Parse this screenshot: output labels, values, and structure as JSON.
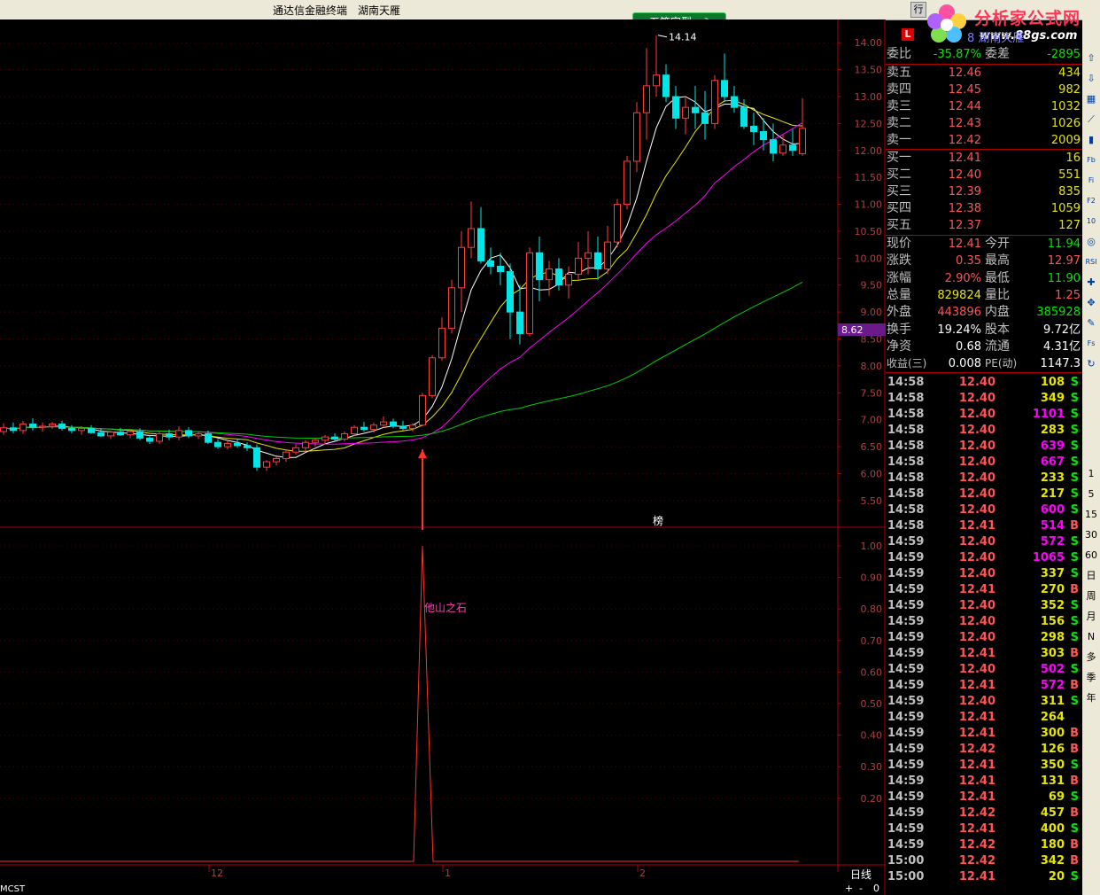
{
  "title_bar": {
    "app": "通达信金融终端",
    "user": "湖南天雁",
    "menu_btn": "行"
  },
  "logo": {
    "brand": "分析家公式网",
    "url": "www.88gs.com"
  },
  "ime": {
    "label": "五笔字型",
    "icon": "moon-icon"
  },
  "stock_header": {
    "code_text": "8 湖南天雁",
    "badge": "L"
  },
  "chart_data": [
    {
      "type": "candlestick",
      "title": "",
      "y_ticks": [
        "14.00",
        "13.50",
        "13.00",
        "12.50",
        "12.00",
        "11.50",
        "11.00",
        "10.50",
        "10.00",
        "9.50",
        "9.00",
        "8.50",
        "8.00",
        "7.50",
        "7.00",
        "6.50",
        "6.00",
        "5.50"
      ],
      "ylim": [
        5.3,
        14.3
      ],
      "high_label": "14.14",
      "current_price_tag": "8.62",
      "x_labels": [
        "12",
        "1",
        "2"
      ],
      "marker_text": "榜",
      "candles": [
        [
          6.78,
          6.93,
          6.72,
          6.85
        ],
        [
          6.85,
          6.95,
          6.75,
          6.8
        ],
        [
          6.8,
          6.98,
          6.74,
          6.92
        ],
        [
          6.92,
          7.03,
          6.8,
          6.86
        ],
        [
          6.86,
          6.95,
          6.78,
          6.88
        ],
        [
          6.88,
          6.96,
          6.83,
          6.92
        ],
        [
          6.92,
          6.98,
          6.8,
          6.84
        ],
        [
          6.84,
          6.9,
          6.75,
          6.8
        ],
        [
          6.8,
          6.88,
          6.72,
          6.84
        ],
        [
          6.84,
          6.9,
          6.74,
          6.76
        ],
        [
          6.76,
          6.84,
          6.68,
          6.7
        ],
        [
          6.7,
          6.8,
          6.64,
          6.77
        ],
        [
          6.77,
          6.85,
          6.7,
          6.72
        ],
        [
          6.72,
          6.82,
          6.66,
          6.78
        ],
        [
          6.78,
          6.84,
          6.62,
          6.66
        ],
        [
          6.66,
          6.72,
          6.55,
          6.6
        ],
        [
          6.6,
          6.78,
          6.55,
          6.74
        ],
        [
          6.74,
          6.82,
          6.62,
          6.68
        ],
        [
          6.68,
          6.88,
          6.62,
          6.8
        ],
        [
          6.8,
          6.86,
          6.66,
          6.7
        ],
        [
          6.7,
          6.78,
          6.64,
          6.74
        ],
        [
          6.74,
          6.8,
          6.55,
          6.58
        ],
        [
          6.58,
          6.64,
          6.46,
          6.5
        ],
        [
          6.5,
          6.62,
          6.45,
          6.56
        ],
        [
          6.56,
          6.64,
          6.48,
          6.52
        ],
        [
          6.52,
          6.58,
          6.42,
          6.48
        ],
        [
          6.48,
          6.54,
          6.05,
          6.12
        ],
        [
          6.12,
          6.25,
          6.05,
          6.22
        ],
        [
          6.22,
          6.32,
          6.15,
          6.28
        ],
        [
          6.28,
          6.45,
          6.22,
          6.4
        ],
        [
          6.4,
          6.55,
          6.35,
          6.48
        ],
        [
          6.48,
          6.62,
          6.4,
          6.58
        ],
        [
          6.58,
          6.66,
          6.5,
          6.62
        ],
        [
          6.62,
          6.72,
          6.55,
          6.68
        ],
        [
          6.68,
          6.75,
          6.6,
          6.64
        ],
        [
          6.64,
          6.78,
          6.6,
          6.74
        ],
        [
          6.74,
          6.9,
          6.7,
          6.86
        ],
        [
          6.86,
          6.96,
          6.78,
          6.82
        ],
        [
          6.82,
          6.95,
          6.76,
          6.9
        ],
        [
          6.9,
          7.06,
          6.85,
          6.96
        ],
        [
          6.96,
          7.02,
          6.84,
          6.88
        ],
        [
          6.88,
          6.98,
          6.8,
          6.84
        ],
        [
          6.84,
          6.94,
          6.78,
          6.9
        ],
        [
          6.9,
          7.5,
          6.88,
          7.45
        ],
        [
          7.45,
          8.2,
          7.4,
          8.15
        ],
        [
          8.15,
          8.9,
          8.1,
          8.7
        ],
        [
          8.7,
          9.6,
          8.6,
          9.45
        ],
        [
          9.45,
          10.5,
          9.0,
          10.2
        ],
        [
          10.2,
          11.05,
          10.0,
          10.55
        ],
        [
          10.55,
          10.95,
          9.9,
          9.95
        ],
        [
          9.95,
          10.2,
          9.7,
          9.85
        ],
        [
          9.85,
          10.1,
          9.5,
          9.75
        ],
        [
          9.75,
          9.9,
          8.5,
          9.0
        ],
        [
          9.0,
          9.5,
          8.4,
          8.6
        ],
        [
          8.6,
          10.2,
          8.55,
          10.1
        ],
        [
          10.1,
          10.4,
          9.2,
          9.6
        ],
        [
          9.6,
          9.95,
          9.3,
          9.8
        ],
        [
          9.8,
          10.0,
          9.4,
          9.5
        ],
        [
          9.5,
          9.85,
          9.25,
          9.7
        ],
        [
          9.7,
          10.3,
          9.6,
          10.0
        ],
        [
          10.0,
          10.5,
          9.7,
          10.1
        ],
        [
          10.1,
          10.4,
          9.6,
          9.8
        ],
        [
          9.8,
          10.6,
          9.7,
          10.3
        ],
        [
          10.3,
          11.1,
          10.2,
          11.0
        ],
        [
          11.0,
          11.9,
          10.9,
          11.8
        ],
        [
          11.8,
          12.9,
          11.6,
          12.7
        ],
        [
          12.7,
          13.9,
          12.2,
          13.2
        ],
        [
          13.2,
          14.14,
          13.0,
          13.4
        ],
        [
          13.4,
          13.6,
          12.9,
          13.0
        ],
        [
          13.0,
          13.2,
          12.4,
          12.6
        ],
        [
          12.6,
          13.0,
          12.3,
          12.8
        ],
        [
          12.8,
          13.2,
          12.4,
          12.7
        ],
        [
          12.7,
          13.1,
          12.2,
          12.5
        ],
        [
          12.5,
          13.4,
          12.4,
          13.3
        ],
        [
          13.3,
          13.8,
          12.9,
          13.0
        ],
        [
          13.0,
          13.2,
          12.7,
          12.8
        ],
        [
          12.8,
          12.95,
          12.4,
          12.45
        ],
        [
          12.45,
          12.7,
          12.1,
          12.35
        ],
        [
          12.35,
          12.6,
          12.0,
          12.2
        ],
        [
          12.2,
          12.5,
          11.8,
          11.95
        ],
        [
          11.95,
          12.3,
          11.9,
          12.1
        ],
        [
          12.1,
          12.4,
          11.9,
          12.0
        ],
        [
          11.94,
          12.97,
          11.9,
          12.41
        ]
      ]
    },
    {
      "type": "line",
      "title": "他山之石",
      "y_ticks": [
        "1.00",
        "0.90",
        "0.80",
        "0.70",
        "0.60",
        "0.50",
        "0.40",
        "0.30",
        "0.20"
      ],
      "ylim": [
        0,
        1.0
      ],
      "signal_index": 43,
      "values_note": "",
      "signal_value": 1.0
    }
  ],
  "quote": {
    "weibi_label": "委比",
    "weibi": "-35.87%",
    "weicha_label": "委差",
    "weicha": "-2895",
    "asks": [
      {
        "label": "卖五",
        "price": "12.46",
        "vol": "434"
      },
      {
        "label": "卖四",
        "price": "12.45",
        "vol": "982"
      },
      {
        "label": "卖三",
        "price": "12.44",
        "vol": "1032"
      },
      {
        "label": "卖二",
        "price": "12.43",
        "vol": "1026"
      },
      {
        "label": "卖一",
        "price": "12.42",
        "vol": "2009"
      }
    ],
    "bids": [
      {
        "label": "买一",
        "price": "12.41",
        "vol": "16"
      },
      {
        "label": "买二",
        "price": "12.40",
        "vol": "551"
      },
      {
        "label": "买三",
        "price": "12.39",
        "vol": "835"
      },
      {
        "label": "买四",
        "price": "12.38",
        "vol": "1059"
      },
      {
        "label": "买五",
        "price": "12.37",
        "vol": "127"
      }
    ],
    "stats": [
      {
        "l1": "现价",
        "v1": "12.41",
        "c1": "red",
        "l2": "今开",
        "v2": "11.94",
        "c2": "grn"
      },
      {
        "l1": "涨跌",
        "v1": "0.35",
        "c1": "red",
        "l2": "最高",
        "v2": "12.97",
        "c2": "red"
      },
      {
        "l1": "涨幅",
        "v1": "2.90%",
        "c1": "red",
        "l2": "最低",
        "v2": "11.90",
        "c2": "grn"
      },
      {
        "l1": "总量",
        "v1": "829824",
        "c1": "yel",
        "l2": "量比",
        "v2": "1.25",
        "c2": "red"
      },
      {
        "l1": "外盘",
        "v1": "443896",
        "c1": "red",
        "l2": "内盘",
        "v2": "385928",
        "c2": "grn"
      },
      {
        "l1": "换手",
        "v1": "19.24%",
        "c1": "wht",
        "l2": "股本",
        "v2": "9.72亿",
        "c2": "wht"
      },
      {
        "l1": "净资",
        "v1": "0.68",
        "c1": "wht",
        "l2": "流通",
        "v2": "4.31亿",
        "c2": "wht"
      },
      {
        "l1": "收益(三)",
        "v1": "0.008",
        "c1": "wht",
        "l2": "PE(动)",
        "v2": "1147.3",
        "c2": "wht"
      }
    ]
  },
  "ticks": [
    [
      "14:58",
      "12.40",
      "108",
      "S"
    ],
    [
      "14:58",
      "12.40",
      "349",
      "S"
    ],
    [
      "14:58",
      "12.40",
      "1101",
      "S"
    ],
    [
      "14:58",
      "12.40",
      "283",
      "S"
    ],
    [
      "14:58",
      "12.40",
      "639",
      "S"
    ],
    [
      "14:58",
      "12.40",
      "667",
      "S"
    ],
    [
      "14:58",
      "12.40",
      "233",
      "S"
    ],
    [
      "14:58",
      "12.40",
      "217",
      "S"
    ],
    [
      "14:58",
      "12.40",
      "600",
      "S"
    ],
    [
      "14:58",
      "12.41",
      "514",
      "B"
    ],
    [
      "14:59",
      "12.40",
      "572",
      "S"
    ],
    [
      "14:59",
      "12.40",
      "1065",
      "S"
    ],
    [
      "14:59",
      "12.40",
      "337",
      "S"
    ],
    [
      "14:59",
      "12.41",
      "270",
      "B"
    ],
    [
      "14:59",
      "12.40",
      "352",
      "S"
    ],
    [
      "14:59",
      "12.40",
      "156",
      "S"
    ],
    [
      "14:59",
      "12.40",
      "298",
      "S"
    ],
    [
      "14:59",
      "12.41",
      "303",
      "B"
    ],
    [
      "14:59",
      "12.40",
      "502",
      "S"
    ],
    [
      "14:59",
      "12.41",
      "572",
      "B"
    ],
    [
      "14:59",
      "12.40",
      "311",
      "S"
    ],
    [
      "14:59",
      "12.41",
      "264",
      ""
    ],
    [
      "14:59",
      "12.41",
      "300",
      "B"
    ],
    [
      "14:59",
      "12.42",
      "126",
      "B"
    ],
    [
      "14:59",
      "12.41",
      "350",
      "S"
    ],
    [
      "14:59",
      "12.41",
      "131",
      "B"
    ],
    [
      "14:59",
      "12.41",
      "69",
      "S"
    ],
    [
      "14:59",
      "12.42",
      "457",
      "B"
    ],
    [
      "14:59",
      "12.41",
      "400",
      "S"
    ],
    [
      "14:59",
      "12.42",
      "180",
      "B"
    ],
    [
      "15:00",
      "12.42",
      "342",
      "B"
    ],
    [
      "15:00",
      "12.41",
      "20",
      "S"
    ]
  ],
  "toolbar": [
    "1",
    "5",
    "15",
    "30",
    "60",
    "日",
    "周",
    "月",
    "N",
    "多",
    "季",
    "年"
  ],
  "toolbar_icons": [
    "up-arrow-icon",
    "down-arrow-icon",
    "grid-icon",
    "line-chart-icon",
    "candle-icon",
    "fib-icon",
    "fi-icon",
    "f2-icon",
    "f10-icon",
    "circle-icon",
    "rsi-icon",
    "search-icon",
    "move-icon",
    "pen-icon",
    "fs-icon",
    "refresh-icon"
  ],
  "bottom": {
    "period": "日线",
    "plus": "+",
    "minus": "-",
    "zero": "0",
    "indicator": "MCST"
  },
  "colors": {
    "up": "#ff3c3c",
    "down": "#00e6e6",
    "ma5": "#ffffff",
    "ma10": "#e6e600",
    "ma20": "#ff00ff",
    "ma60": "#00d000",
    "grid": "#b00000"
  }
}
